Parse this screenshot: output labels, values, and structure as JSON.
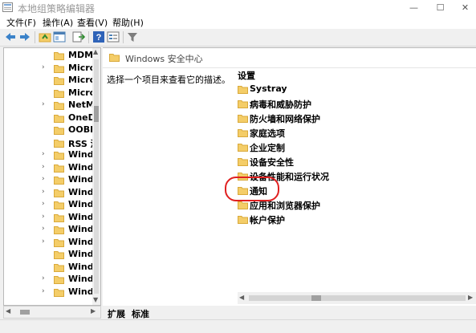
{
  "window": {
    "title": "本地组策略编辑器"
  },
  "menu": [
    "文件(F)",
    "操作(A)",
    "查看(V)",
    "帮助(H)"
  ],
  "tree": {
    "items": [
      {
        "label": "MDM",
        "expandable": false
      },
      {
        "label": "Micro",
        "expandable": true
      },
      {
        "label": "Micro",
        "expandable": false
      },
      {
        "label": "Micro",
        "expandable": false
      },
      {
        "label": "NetM",
        "expandable": true
      },
      {
        "label": "OneD",
        "expandable": false
      },
      {
        "label": "OOBE",
        "expandable": false
      },
      {
        "label": "RSS 源",
        "expandable": false
      },
      {
        "label": "Wind",
        "expandable": true
      },
      {
        "label": "Wind",
        "expandable": true
      },
      {
        "label": "Wind",
        "expandable": true
      },
      {
        "label": "Wind",
        "expandable": true
      },
      {
        "label": "Wind",
        "expandable": true
      },
      {
        "label": "Wind",
        "expandable": true
      },
      {
        "label": "Wind",
        "expandable": true
      },
      {
        "label": "Wind",
        "expandable": true
      },
      {
        "label": "Wind",
        "expandable": false
      },
      {
        "label": "Wind",
        "expandable": false
      },
      {
        "label": "Wind",
        "expandable": true
      },
      {
        "label": "Wind",
        "expandable": true
      }
    ]
  },
  "header": {
    "title": "Windows 安全中心"
  },
  "description": "选择一个项目来查看它的描述。",
  "settings": {
    "column_header": "设置",
    "items": [
      "Systray",
      "病毒和威胁防护",
      "防火墙和网络保护",
      "家庭选项",
      "企业定制",
      "设备安全性",
      "设备性能和运行状况",
      "通知",
      "应用和浏览器保护",
      "帐户保护"
    ]
  },
  "tabs": [
    "扩展",
    "标准"
  ],
  "colors": {
    "folder": "#f4cd68",
    "folder_edge": "#d9a93a",
    "highlight": "#e02020"
  }
}
